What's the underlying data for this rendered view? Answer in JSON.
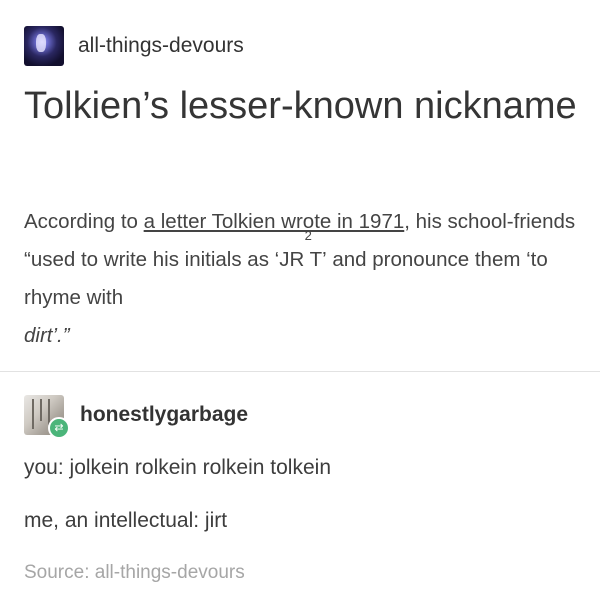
{
  "post": {
    "author": "all-things-devours",
    "title": "Tolkien’s lesser-known nickname",
    "body": {
      "intro_before_link": "According to ",
      "link_text": "a letter Tolkien wrote in 1971",
      "intro_after_link": ", his school-friends “used to write his initials as ",
      "initials_text": "‘JR T’",
      "superscript": "2",
      "outro": " and pronounce them ‘to rhyme with ",
      "italic_end": "dirt’.”"
    }
  },
  "reblog": {
    "author": "honestlygarbage",
    "lines": [
      "you: jolkein rolkein rolkein tolkein",
      "me, an intellectual: jirt"
    ]
  },
  "source": {
    "label": "Source: all-things-devours"
  },
  "icons": {
    "reblog_badge": "reblog-icon"
  },
  "colors": {
    "badge_green": "#4bb57a",
    "source_gray": "#a6a6a6"
  }
}
